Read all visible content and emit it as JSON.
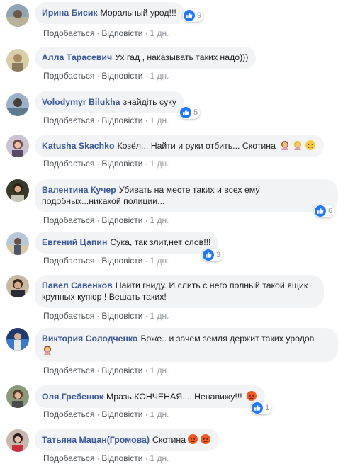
{
  "labels": {
    "like": "Подобається",
    "reply": "Відповісти",
    "sep": "·"
  },
  "comments": [
    {
      "author": "Ирина Бисик",
      "text": "Моральный урод!!!",
      "time": "1 дн.",
      "reactions": "9",
      "reaction_icon": "like-icon"
    },
    {
      "author": "Алла Тарасевич",
      "text": "Ух гад , наказывать таких надо)))",
      "time": "1 дн."
    },
    {
      "author": "Volodymyr Bilukha",
      "text": "знайдіть суку",
      "time": "1 дн.",
      "reactions": "5",
      "reaction_icon": "like-icon"
    },
    {
      "author": "Katusha Skachko",
      "text": "Козёл... Найти и руки отбить... Скотина",
      "time": "1 дн.",
      "emojis": [
        "woman-gesturing-no-emoji",
        "woman-gesturing-no-emoji",
        "disappointed-face-emoji"
      ]
    },
    {
      "author": "Валентина Кучер",
      "text": "Убивать на месте таких и всех ему подобных...никакой полиции...",
      "time": "1 дн.",
      "reactions": "6",
      "reaction_icon": "like-icon"
    },
    {
      "author": "Евгений Цапин",
      "text": "Сука, так злит,нет слов!!!",
      "time": "1 дн.",
      "reactions": "3",
      "reaction_icon": "like-icon"
    },
    {
      "author": "Павел Савенков",
      "text": "Найти гниду. И слить с него полный такой ящик крупных купюр ! Вешать таких!",
      "time": "1 дн."
    },
    {
      "author": "Виктория Солодченко",
      "text": "Боже.. и зачем земля держит таких уродов",
      "time": "1 дн.",
      "emojis": [
        "woman-gesturing-no-emoji"
      ]
    },
    {
      "author": "Оля Гребенюк",
      "text": "Мразь КОНЧЕНАЯ.... Ненавижу!!!",
      "time": "1 дн.",
      "reactions": "1",
      "reaction_icon": "like-icon",
      "emojis": [
        "angry-face-emoji"
      ]
    },
    {
      "author": "Татьяна Мацан(Громова)",
      "text": "Скотина",
      "time": "1 дн.",
      "emojis": [
        "angry-face-emoji",
        "angry-face-emoji"
      ]
    }
  ],
  "colors": {
    "author": "#385898",
    "bubble": "#f2f3f5",
    "like_blue": "#2078f4",
    "meta": "#90949c"
  }
}
